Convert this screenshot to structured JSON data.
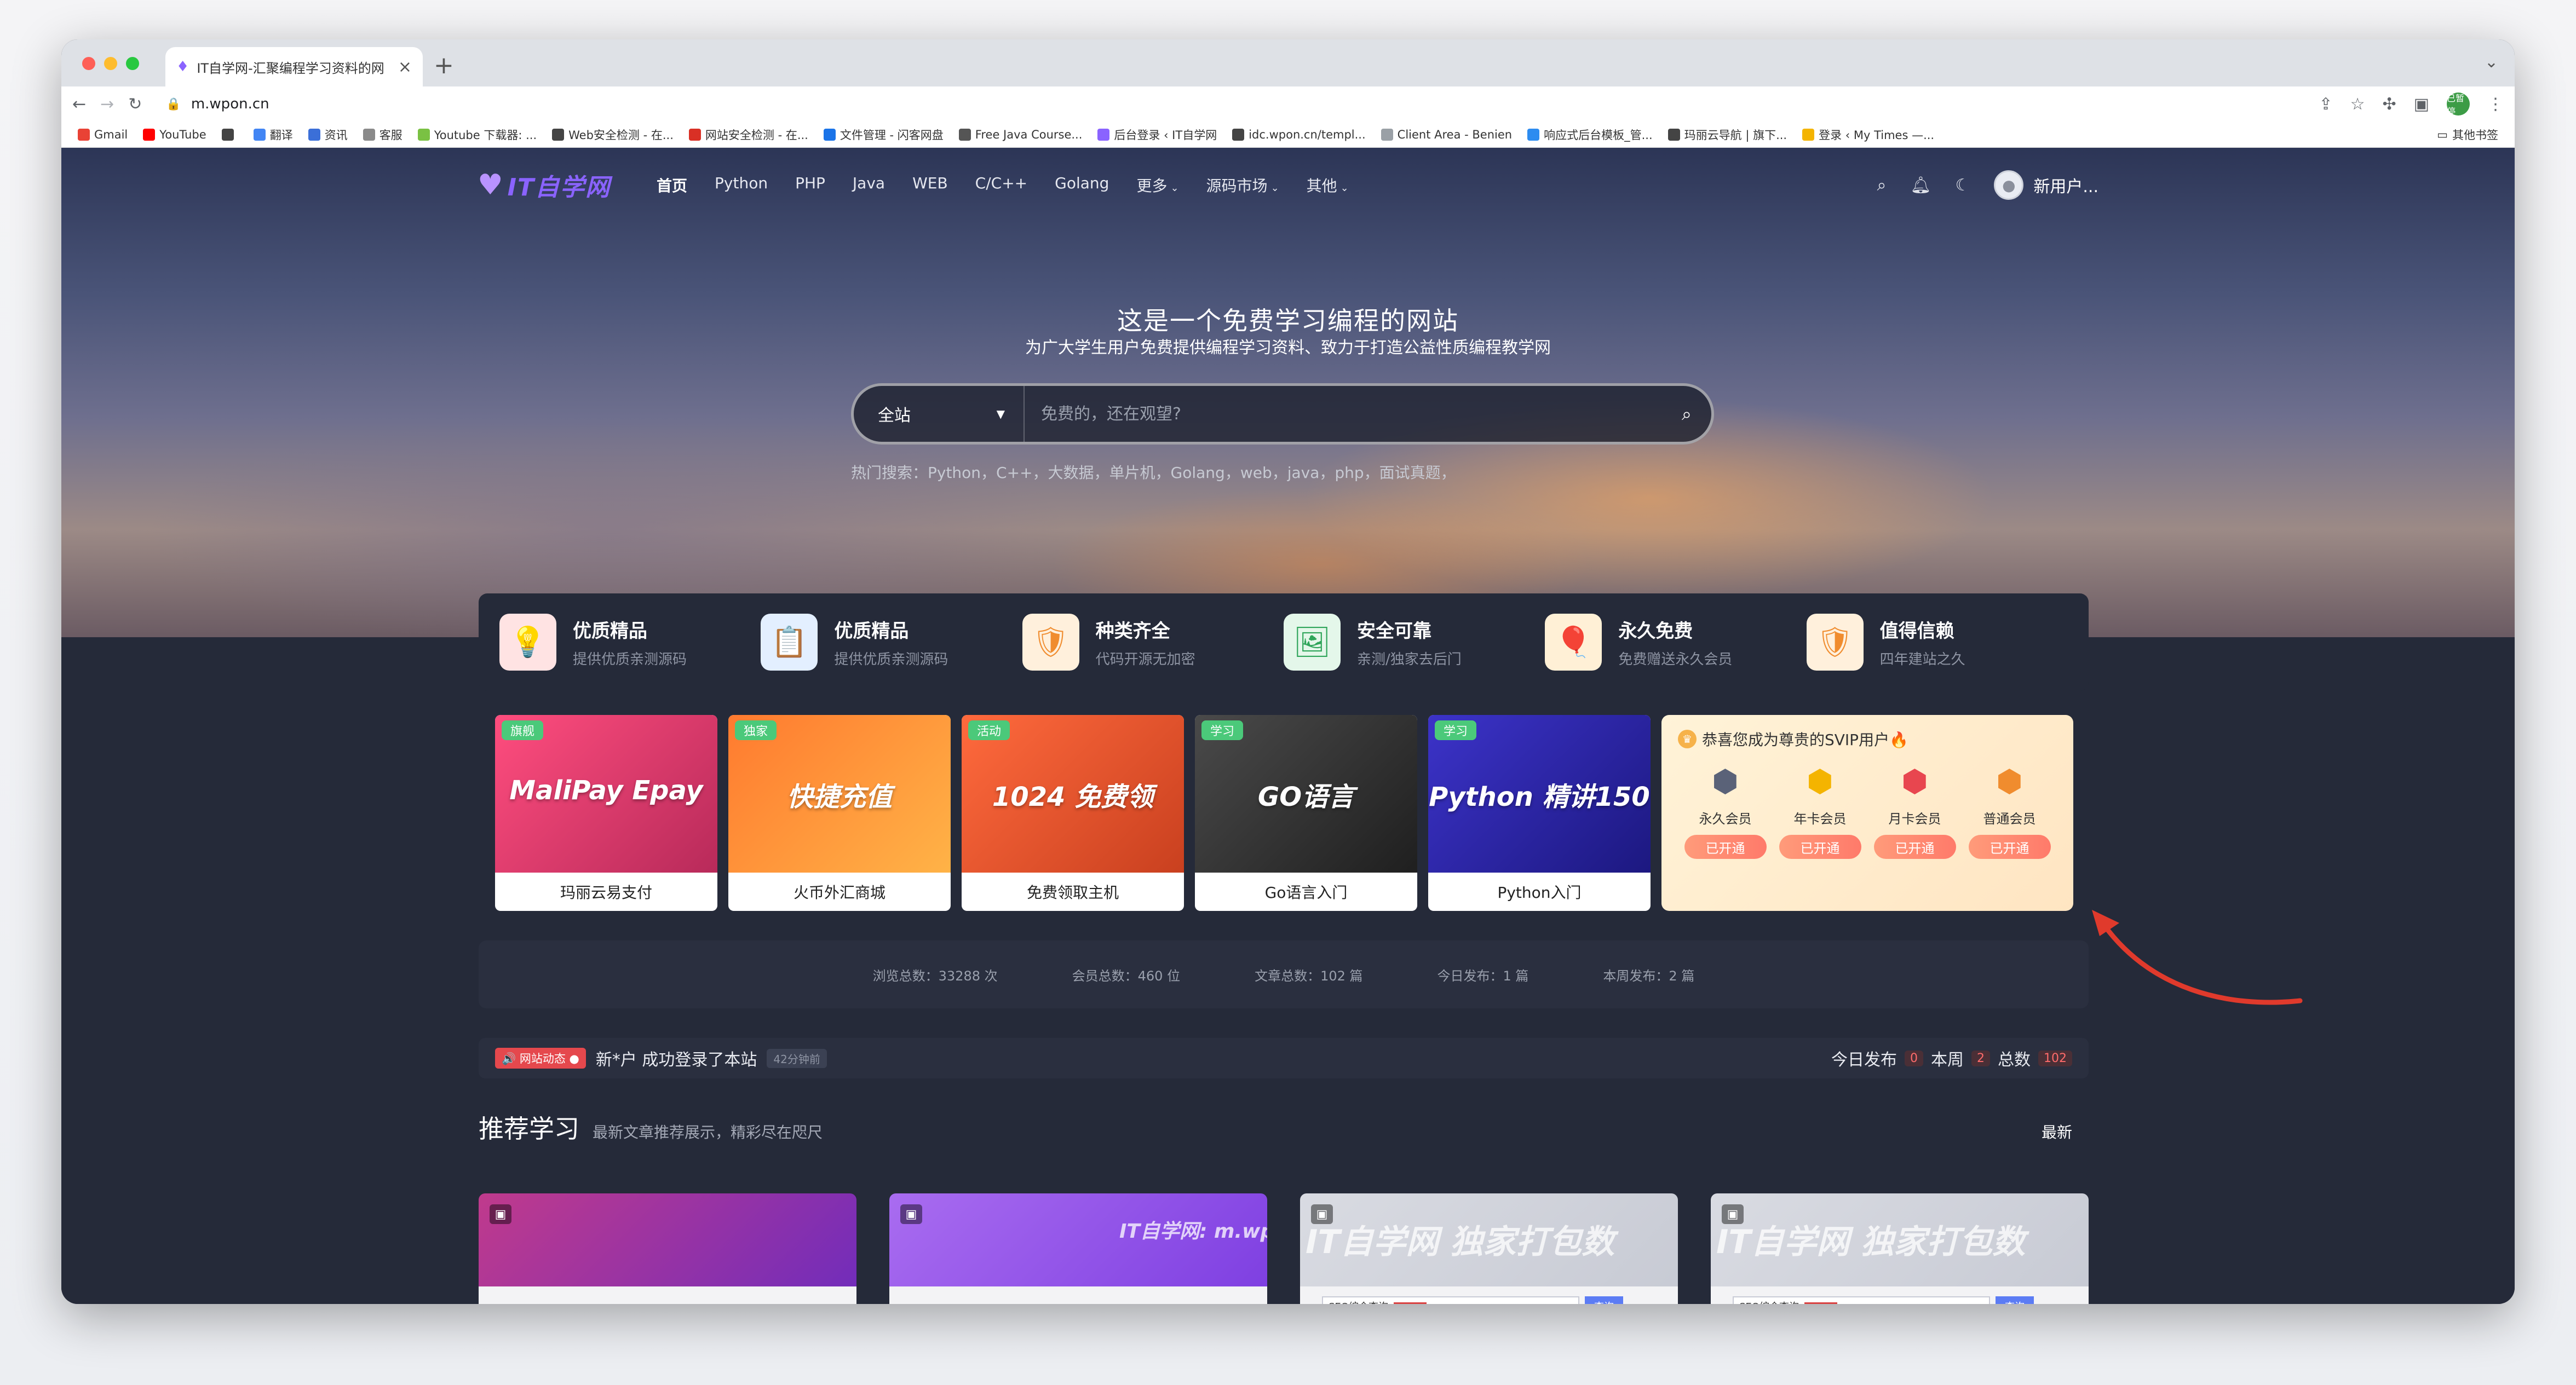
{
  "browser": {
    "tab_title": "IT自学网-汇聚编程学习资料的网",
    "url": "m.wpon.cn",
    "profile_label": "已暂停",
    "bookmarks": [
      {
        "label": "Gmail",
        "color": "#e94235"
      },
      {
        "label": "YouTube",
        "color": "#ff0000"
      },
      {
        "label": "",
        "color": "#444444"
      },
      {
        "label": "翻译",
        "color": "#4285f4"
      },
      {
        "label": "资讯",
        "color": "#3b6fd8"
      },
      {
        "label": "客服",
        "color": "#8a8a8a"
      },
      {
        "label": "Youtube 下载器: ...",
        "color": "#7ac143"
      },
      {
        "label": "Web安全检测 - 在...",
        "color": "#444444"
      },
      {
        "label": "网站安全检测 - 在...",
        "color": "#d93025"
      },
      {
        "label": "文件管理 - 闪客网盘",
        "color": "#1a73e8"
      },
      {
        "label": "Free Java Course...",
        "color": "#555555"
      },
      {
        "label": "后台登录 ‹ IT自学网",
        "color": "#8a63ff"
      },
      {
        "label": "idc.wpon.cn/templ...",
        "color": "#444444"
      },
      {
        "label": "Client Area - Benien",
        "color": "#9aa0a6"
      },
      {
        "label": "响应式后台模板_管...",
        "color": "#2d8cf0"
      },
      {
        "label": "玛丽云导航 | 旗下...",
        "color": "#444444"
      },
      {
        "label": "登录 ‹ My Times —...",
        "color": "#f4b400"
      }
    ],
    "other_bookmarks": "其他书签"
  },
  "site": {
    "logo_text": "IT自学网",
    "nav": [
      "首页",
      "Python",
      "PHP",
      "Java",
      "WEB",
      "C/C++",
      "Golang",
      "更多",
      "源码市场",
      "其他"
    ],
    "user_name": "新用户...",
    "hero_title": "这是一个免费学习编程的网站",
    "hero_subtitle": "为广大学生用户免费提供编程学习资料、致力于打造公益性质编程教学网",
    "search_scope": "全站",
    "search_placeholder": "免费的，还在观望?",
    "hot_search": "热门搜索：Python，C++，大数据，单片机，Golang，web，java，php，面试真题，",
    "features": [
      {
        "title": "优质精品",
        "desc": "提供优质亲测源码",
        "icon": "bulb-icon",
        "bg": "#ffe3e3",
        "fg": "#e04b4b",
        "glyph": "💡"
      },
      {
        "title": "优质精品",
        "desc": "提供优质亲测源码",
        "icon": "board-icon",
        "bg": "#e3efff",
        "fg": "#3b82f6",
        "glyph": "📋"
      },
      {
        "title": "种类齐全",
        "desc": "代码开源无加密",
        "icon": "shield-check-icon",
        "bg": "#fff0dc",
        "fg": "#f08c2e",
        "glyph": "🛡"
      },
      {
        "title": "安全可靠",
        "desc": "亲测/独家去后门",
        "icon": "image-icon",
        "bg": "#e4f7ea",
        "fg": "#2fa55a",
        "glyph": "🖼"
      },
      {
        "title": "永久免费",
        "desc": "免费赠送永久会员",
        "icon": "balloon-icon",
        "bg": "#fff0d6",
        "fg": "#f3a43b",
        "glyph": "🎈"
      },
      {
        "title": "值得信赖",
        "desc": "四年建站之久",
        "icon": "shield-icon",
        "bg": "#fff0dc",
        "fg": "#f08c2e",
        "glyph": "🛡"
      }
    ],
    "cards": [
      {
        "tag": "旗舰",
        "label": "玛丽云易支付",
        "tag_color": "#4bc97a",
        "img_text": "MaliPay Epay",
        "bg": "linear-gradient(135deg,#ff4d7e,#b82a5a)"
      },
      {
        "tag": "独家",
        "label": "火币外汇商城",
        "tag_color": "#4bc97a",
        "img_text": "快捷充值",
        "bg": "linear-gradient(135deg,#ff7a2f,#ffb347)"
      },
      {
        "tag": "活动",
        "label": "免费领取主机",
        "tag_color": "#4bc97a",
        "img_text": "1024 免费领",
        "bg": "linear-gradient(135deg,#ff6a3d,#c9401f)"
      },
      {
        "tag": "学习",
        "label": "Go语言入门",
        "tag_color": "#4bc97a",
        "img_text": "GO语言",
        "bg": "linear-gradient(135deg,#4a4a4a,#1f1f1f)"
      },
      {
        "tag": "学习",
        "label": "Python入门",
        "tag_color": "#4bc97a",
        "img_text": "Python 精讲150",
        "bg": "linear-gradient(135deg,#3c33c9,#1c1880)"
      }
    ],
    "svip": {
      "title": "恭喜您成为尊贵的SVIP用户🔥",
      "tiers": [
        {
          "name": "永久会员",
          "button": "已开通",
          "color": "#5a6278"
        },
        {
          "name": "年卡会员",
          "button": "已开通",
          "color": "#f4b400"
        },
        {
          "name": "月卡会员",
          "button": "已开通",
          "color": "#e8464f"
        },
        {
          "name": "普通会员",
          "button": "已开通",
          "color": "#f08c2e"
        }
      ]
    },
    "stats": [
      "浏览总数：33288 次",
      "会员总数：460 位",
      "文章总数：102 篇",
      "今日发布：1 篇",
      "本周发布：2 篇"
    ],
    "news": {
      "badge": "🔊 网站动态 ●",
      "text": "新*户 成功登录了本站",
      "time": "42分钟前",
      "today_label": "今日发布",
      "today_count": "0",
      "week_label": "本周",
      "week_count": "2",
      "total_label": "总数",
      "total_count": "102"
    },
    "recommend": {
      "title": "推荐学习",
      "subtitle": "最新文章推荐展示，精彩尽在咫尺",
      "more": "最新",
      "items": [
        {
          "watermark": "",
          "bg": "linear-gradient(135deg,#c03a8c,#6a2bbf)"
        },
        {
          "watermark": "IT自学网: m.wpon.cn",
          "bg": "linear-gradient(135deg,#a96cf0,#7a3be0)"
        },
        {
          "watermark": "IT自学网  独家打包数",
          "bg": "linear-gradient(135deg,#d9dbe2,#c6c9d3)",
          "field": "SEO综合查询",
          "go": "查询"
        },
        {
          "watermark": "IT自学网  独家打包数",
          "bg": "linear-gradient(135deg,#d9dbe2,#c6c9d3)",
          "field": "SEO综合查询",
          "go": "查询"
        }
      ]
    }
  }
}
